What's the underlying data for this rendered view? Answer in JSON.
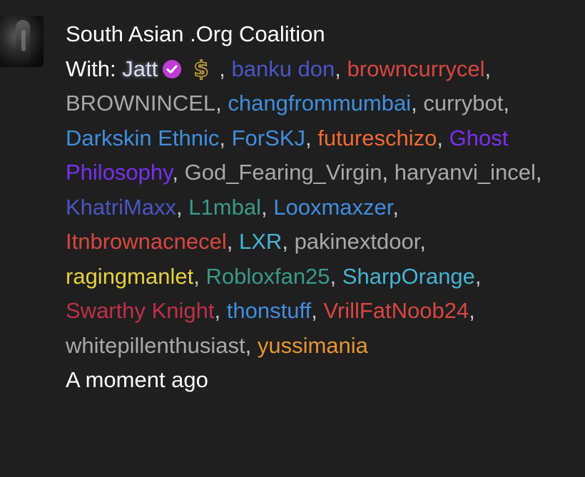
{
  "chat": {
    "title": "South Asian .Org Coalition",
    "with_label": "With:",
    "timestamp": "A moment ago",
    "verified_icon": "check-badge-icon",
    "premium_icon": "dollar-icon",
    "colors": {
      "verified": "#c13cd6",
      "gold": "#c9a23a"
    },
    "participants": [
      {
        "name": "Jatt",
        "color": "#d9dcf2"
      },
      {
        "name": "banku don",
        "color": "#4a55c4"
      },
      {
        "name": "browncurrycel",
        "color": "#d9473f"
      },
      {
        "name": "BROWNINCEL",
        "color": "#a9a9a9"
      },
      {
        "name": "changfrommumbai",
        "color": "#3f8fdf"
      },
      {
        "name": "currybot",
        "color": "#a9a9a9"
      },
      {
        "name": "Darkskin Ethnic",
        "color": "#3f8fdf"
      },
      {
        "name": "ForSKJ",
        "color": "#3f8fdf"
      },
      {
        "name": "futureschizo",
        "color": "#f06a35"
      },
      {
        "name": "Ghost Philosophy",
        "color": "#7a2ff0"
      },
      {
        "name": "God_Fearing_Virgin",
        "color": "#a9a9a9"
      },
      {
        "name": "haryanvi_incel",
        "color": "#a9a9a9"
      },
      {
        "name": "KhatriMaxx",
        "color": "#4a55c4"
      },
      {
        "name": "L1mbal",
        "color": "#3a9a87"
      },
      {
        "name": "Looxmaxzer",
        "color": "#3f8fdf"
      },
      {
        "name": "Itnbrownacnecel",
        "color": "#d9473f"
      },
      {
        "name": "LXR",
        "color": "#46b4d4"
      },
      {
        "name": "pakinextdoor",
        "color": "#a9a9a9"
      },
      {
        "name": "ragingmanlet",
        "color": "#e6d23f"
      },
      {
        "name": "Robloxfan25",
        "color": "#3a9a87"
      },
      {
        "name": "SharpOrange",
        "color": "#46b4d4"
      },
      {
        "name": "Swarthy Knight",
        "color": "#c0304a"
      },
      {
        "name": "thonstuff",
        "color": "#3f8fdf"
      },
      {
        "name": "VrillFatNoob24",
        "color": "#d9473f"
      },
      {
        "name": "whitepillenthusiast",
        "color": "#a9a9a9"
      },
      {
        "name": "yussimania",
        "color": "#e8962e"
      }
    ]
  }
}
